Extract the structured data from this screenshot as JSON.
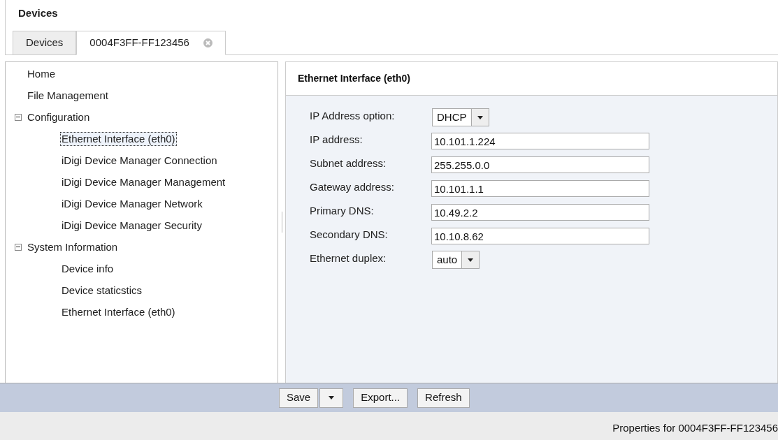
{
  "header": {
    "title": "Devices"
  },
  "tabs": [
    {
      "label": "Devices",
      "selected": false,
      "closable": false
    },
    {
      "label": "0004F3FF-FF123456",
      "selected": true,
      "closable": true
    }
  ],
  "tree": [
    {
      "label": "Home",
      "selected": false
    },
    {
      "label": "File Management",
      "selected": false
    },
    {
      "label": "Configuration",
      "selected": false,
      "expanded": true,
      "children": [
        {
          "label": "Ethernet Interface (eth0)",
          "selected": true
        },
        {
          "label": "iDigi Device Manager Connection",
          "selected": false
        },
        {
          "label": "iDigi Device Manager Management",
          "selected": false
        },
        {
          "label": "iDigi Device Manager Network",
          "selected": false
        },
        {
          "label": "iDigi Device Manager Security",
          "selected": false
        }
      ]
    },
    {
      "label": "System Information",
      "selected": false,
      "expanded": true,
      "children": [
        {
          "label": "Device info",
          "selected": false
        },
        {
          "label": "Device staticstics",
          "selected": false
        },
        {
          "label": "Ethernet Interface (eth0)",
          "selected": false
        }
      ]
    }
  ],
  "panel": {
    "title": "Ethernet Interface (eth0)",
    "fields": [
      {
        "kind": "select",
        "label": "IP Address option:",
        "value": "DHCP"
      },
      {
        "kind": "text",
        "label": "IP address:",
        "value": "10.101.1.224"
      },
      {
        "kind": "text",
        "label": "Subnet address:",
        "value": "255.255.0.0"
      },
      {
        "kind": "text",
        "label": "Gateway address:",
        "value": "10.101.1.1"
      },
      {
        "kind": "text",
        "label": "Primary DNS:",
        "value": "10.49.2.2"
      },
      {
        "kind": "text",
        "label": "Secondary DNS:",
        "value": "10.10.8.62"
      },
      {
        "kind": "select",
        "label": "Ethernet duplex:",
        "value": "auto"
      }
    ]
  },
  "toolbar": {
    "buttons": [
      {
        "label": "Save",
        "kind": "split"
      },
      {
        "label": "Export...",
        "kind": "plain"
      },
      {
        "label": "Refresh",
        "kind": "plain"
      }
    ]
  },
  "status_bar": {
    "text": "Properties for 0004F3FF-FF123456"
  }
}
